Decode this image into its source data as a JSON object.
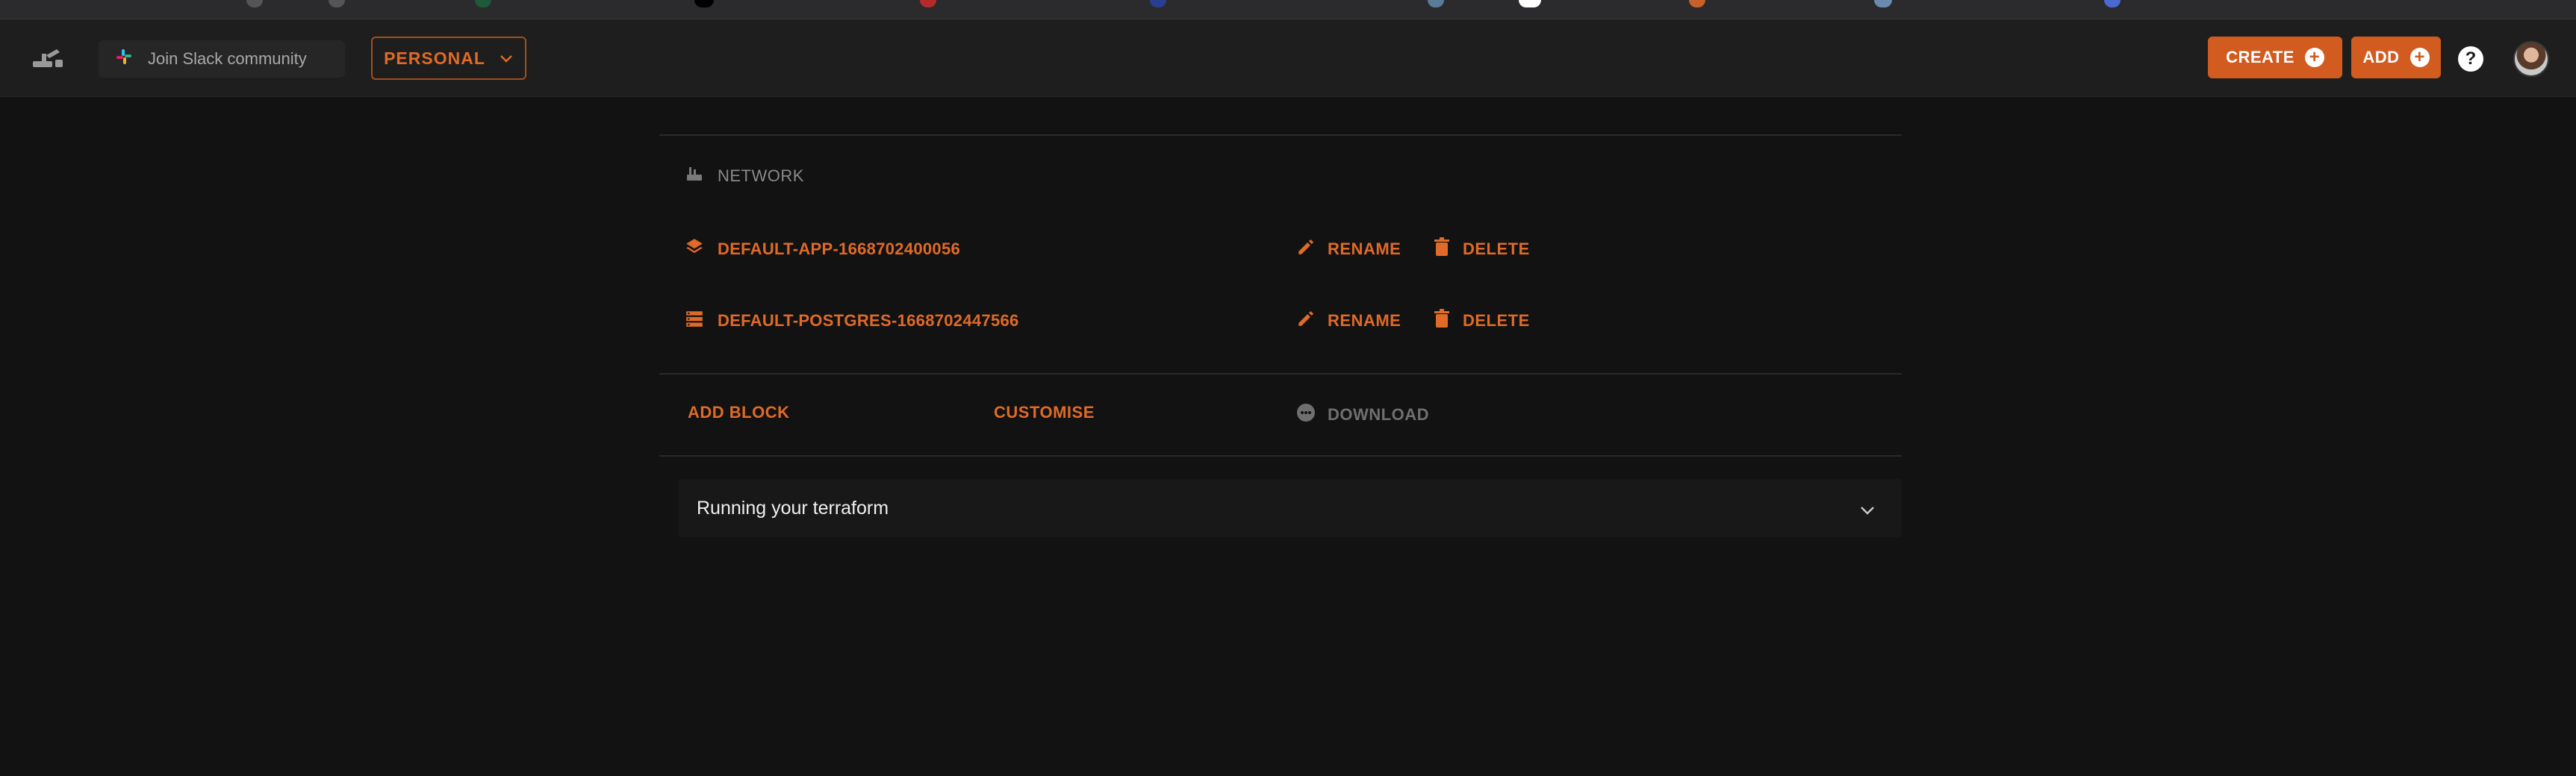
{
  "header": {
    "slack_label": "Join Slack community",
    "workspace_label": "PERSONAL",
    "create_label": "CREATE",
    "add_label": "ADD",
    "help_glyph": "?"
  },
  "main": {
    "section_label": "NETWORK",
    "blocks": [
      {
        "name": "DEFAULT-APP-1668702400056",
        "icon": "layers-icon",
        "rename_label": "RENAME",
        "delete_label": "DELETE"
      },
      {
        "name": "DEFAULT-POSTGRES-1668702447566",
        "icon": "database-list-icon",
        "rename_label": "RENAME",
        "delete_label": "DELETE"
      }
    ],
    "actions": {
      "add_block": "ADD BLOCK",
      "customise": "CUSTOMISE",
      "download": "DOWNLOAD"
    },
    "accordion_title": "Running your terraform"
  },
  "colors": {
    "accent": "#e06a27",
    "button_bg": "#d25b1f",
    "page_bg": "#121212",
    "topbar_bg": "#1e1e1e"
  }
}
